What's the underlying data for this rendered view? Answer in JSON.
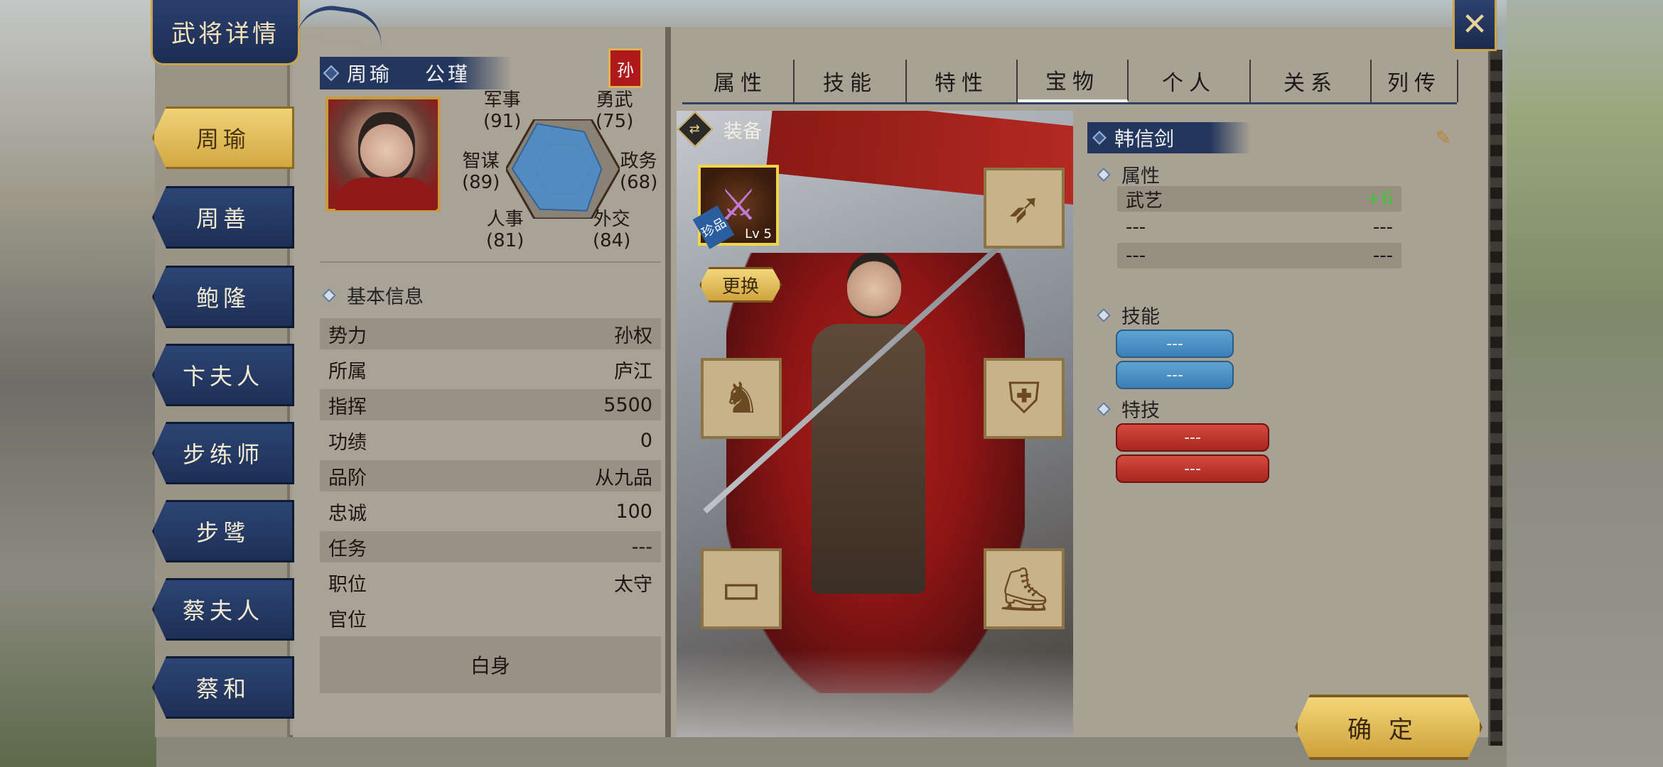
{
  "title": "武将详情",
  "close_icon": "crossed-swords-close",
  "heroes": [
    {
      "label": "周瑜",
      "active": true
    },
    {
      "label": "周善"
    },
    {
      "label": "鲍隆"
    },
    {
      "label": "卞夫人"
    },
    {
      "label": "步练师"
    },
    {
      "label": "步骘"
    },
    {
      "label": "蔡夫人"
    },
    {
      "label": "蔡和"
    }
  ],
  "profile": {
    "name": "周瑜",
    "courtesy": "公瑾",
    "faction_badge": "孙"
  },
  "stats": {
    "military": {
      "label": "军事",
      "value": "(91)"
    },
    "valor": {
      "label": "勇武",
      "value": "(75)"
    },
    "strategy": {
      "label": "智谋",
      "value": "(89)"
    },
    "politics": {
      "label": "政务",
      "value": "(68)"
    },
    "personnel": {
      "label": "人事",
      "value": "(81)"
    },
    "diplomacy": {
      "label": "外交",
      "value": "(84)"
    },
    "radar_values": [
      91,
      75,
      68,
      84,
      81,
      89
    ]
  },
  "basic_info": {
    "header": "基本信息",
    "rows": [
      {
        "label": "势力",
        "value": "孙权"
      },
      {
        "label": "所属",
        "value": "庐江"
      },
      {
        "label": "指挥",
        "value": "5500"
      },
      {
        "label": "功绩",
        "value": "0"
      },
      {
        "label": "品阶",
        "value": "从九品"
      },
      {
        "label": "忠诚",
        "value": "100"
      },
      {
        "label": "任务",
        "value": "---"
      },
      {
        "label": "职位",
        "value": "太守"
      },
      {
        "label": "官位",
        "value": ""
      }
    ],
    "rank_title": "白身"
  },
  "tabs": [
    "属性",
    "技能",
    "特性",
    "宝物",
    "个人",
    "关系",
    "列传"
  ],
  "active_tab": "宝物",
  "equipment": {
    "header": "装备",
    "weapon_level": "Lv 5",
    "weapon_rarity": "珍品",
    "change_label": "更换",
    "slot_icons": [
      "sword",
      "bow",
      "horse",
      "armor",
      "scroll",
      "boots"
    ]
  },
  "treasure": {
    "name": "韩信剑",
    "attr_header": "属性",
    "attrs": [
      {
        "label": "武艺",
        "value": "+6"
      },
      {
        "label": "---",
        "value": "---"
      },
      {
        "label": "---",
        "value": "---"
      }
    ],
    "skill_header": "技能",
    "skills": [
      "---",
      "---"
    ],
    "special_header": "特技",
    "specials": [
      "---",
      "---"
    ]
  },
  "confirm_label": "确定",
  "colors": {
    "panel": "#a39d90",
    "navy": "#23365e",
    "gold": "#d3a843",
    "plus": "#43c43a"
  }
}
